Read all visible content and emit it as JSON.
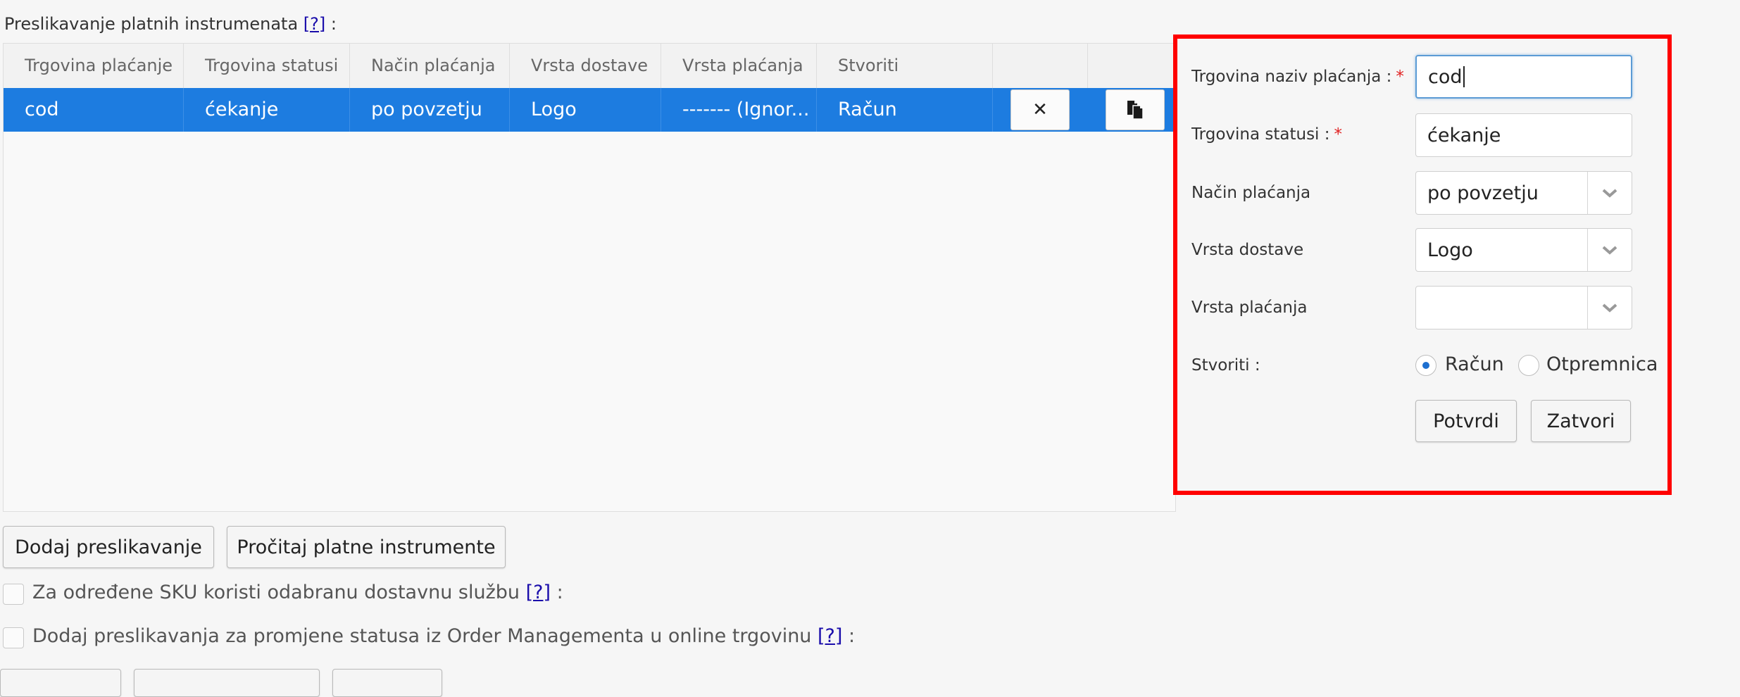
{
  "section": {
    "title": "Preslikavanje platnih instrumenata",
    "help": "[?]",
    "colon": ":"
  },
  "grid": {
    "columns": [
      "Trgovina plaćanje",
      "Trgovina statusi",
      "Način plaćanja",
      "Vrsta dostave",
      "Vrsta plaćanja",
      "Stvoriti"
    ],
    "rows": [
      {
        "cells": [
          "cod",
          "ćekanje",
          "po povzetju",
          "Logo",
          "------- (Ignor...",
          "Račun"
        ]
      }
    ],
    "delete_glyph": "✕"
  },
  "buttons": {
    "add_mapping": "Dodaj preslikavanje",
    "read_instruments": "Pročitaj platne instrumente"
  },
  "options": {
    "sku_label": "Za određene SKU koristi odabranu dostavnu službu",
    "sku_help": "[?]",
    "sku_colon": ":",
    "status_label": "Dodaj preslikavanja za promjene statusa iz Order Managementa u online trgovinu",
    "status_help": "[?]",
    "status_colon": ":"
  },
  "form": {
    "store_payment_label": "Trgovina naziv plaćanja :",
    "store_payment_value": "cod",
    "store_status_label": "Trgovina statusi :",
    "store_status_value": "ćekanje",
    "required_mark": "*",
    "payment_method_label": "Način plaćanja",
    "payment_method_value": "po povzetju",
    "delivery_type_label": "Vrsta dostave",
    "delivery_type_value": "Logo",
    "payment_type_label": "Vrsta plaćanja",
    "payment_type_value": "",
    "create_label": "Stvoriti :",
    "create_options": [
      "Račun",
      "Otpremnica"
    ],
    "create_selected": "Račun",
    "confirm": "Potvrdi",
    "close": "Zatvori"
  },
  "colors": {
    "selected_row": "#1d7ce0",
    "highlight_border": "#ff0000",
    "required": "#e02020",
    "help_link": "#1a0dab"
  }
}
